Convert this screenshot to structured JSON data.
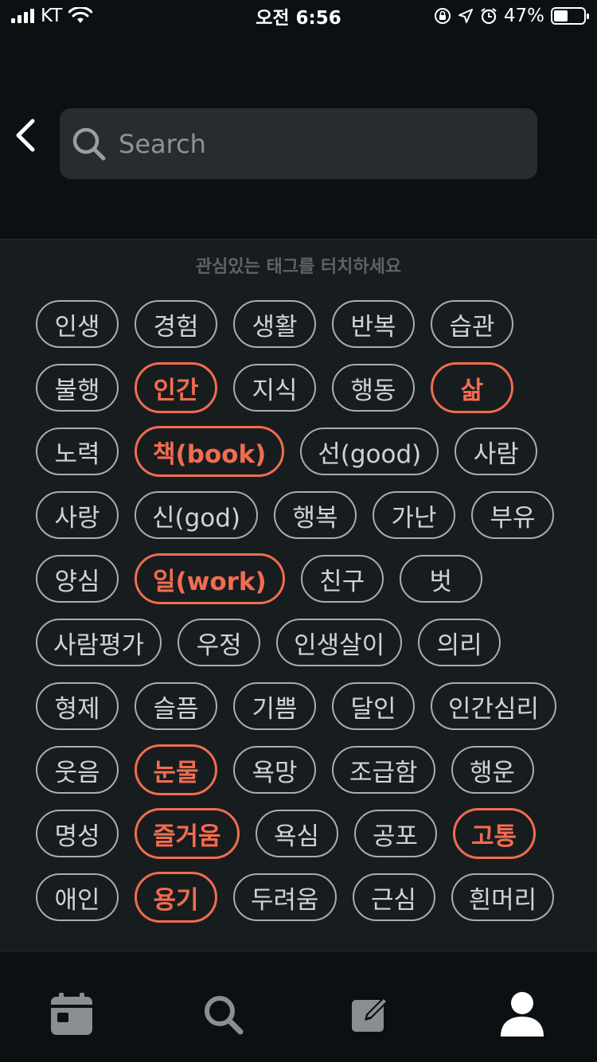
{
  "status_bar": {
    "carrier": "KT",
    "time": "오전 6:56",
    "battery_percent": "47%",
    "battery_level": 0.47
  },
  "search": {
    "placeholder": "Search"
  },
  "hint": "관심있는 태그를 터치하세요",
  "tag_rows": [
    [
      {
        "label": "인생",
        "selected": false
      },
      {
        "label": "경험",
        "selected": false
      },
      {
        "label": "생활",
        "selected": false
      },
      {
        "label": "반복",
        "selected": false
      },
      {
        "label": "습관",
        "selected": false
      }
    ],
    [
      {
        "label": "불행",
        "selected": false
      },
      {
        "label": "인간",
        "selected": true
      },
      {
        "label": "지식",
        "selected": false
      },
      {
        "label": "행동",
        "selected": false
      },
      {
        "label": "삶",
        "selected": true
      }
    ],
    [
      {
        "label": "노력",
        "selected": false
      },
      {
        "label": "책(book)",
        "selected": true
      },
      {
        "label": "선(good)",
        "selected": false
      },
      {
        "label": "사람",
        "selected": false
      }
    ],
    [
      {
        "label": "사랑",
        "selected": false
      },
      {
        "label": "신(god)",
        "selected": false
      },
      {
        "label": "행복",
        "selected": false
      },
      {
        "label": "가난",
        "selected": false
      },
      {
        "label": "부유",
        "selected": false
      }
    ],
    [
      {
        "label": "양심",
        "selected": false
      },
      {
        "label": "일(work)",
        "selected": true
      },
      {
        "label": "친구",
        "selected": false
      },
      {
        "label": "벗",
        "selected": false
      }
    ],
    [
      {
        "label": "사람평가",
        "selected": false
      },
      {
        "label": "우정",
        "selected": false
      },
      {
        "label": "인생살이",
        "selected": false
      },
      {
        "label": "의리",
        "selected": false
      }
    ],
    [
      {
        "label": "형제",
        "selected": false
      },
      {
        "label": "슬픔",
        "selected": false
      },
      {
        "label": "기쁨",
        "selected": false
      },
      {
        "label": "달인",
        "selected": false
      },
      {
        "label": "인간심리",
        "selected": false
      }
    ],
    [
      {
        "label": "웃음",
        "selected": false
      },
      {
        "label": "눈물",
        "selected": true
      },
      {
        "label": "욕망",
        "selected": false
      },
      {
        "label": "조급함",
        "selected": false
      },
      {
        "label": "행운",
        "selected": false
      }
    ],
    [
      {
        "label": "명성",
        "selected": false
      },
      {
        "label": "즐거움",
        "selected": true
      },
      {
        "label": "욕심",
        "selected": false
      },
      {
        "label": "공포",
        "selected": false
      },
      {
        "label": "고통",
        "selected": true
      }
    ],
    [
      {
        "label": "애인",
        "selected": false
      },
      {
        "label": "용기",
        "selected": true
      },
      {
        "label": "두려움",
        "selected": false
      },
      {
        "label": "근심",
        "selected": false
      },
      {
        "label": "흰머리",
        "selected": false
      }
    ]
  ],
  "tabbar": {
    "items": [
      {
        "icon": "calendar-icon"
      },
      {
        "icon": "search-icon"
      },
      {
        "icon": "edit-icon"
      },
      {
        "icon": "profile-icon",
        "active": true
      }
    ]
  },
  "colors": {
    "accent": "#f26c4f",
    "background": "#0b1012",
    "panel": "#171d1f",
    "tag_border": "#a9adaf"
  }
}
